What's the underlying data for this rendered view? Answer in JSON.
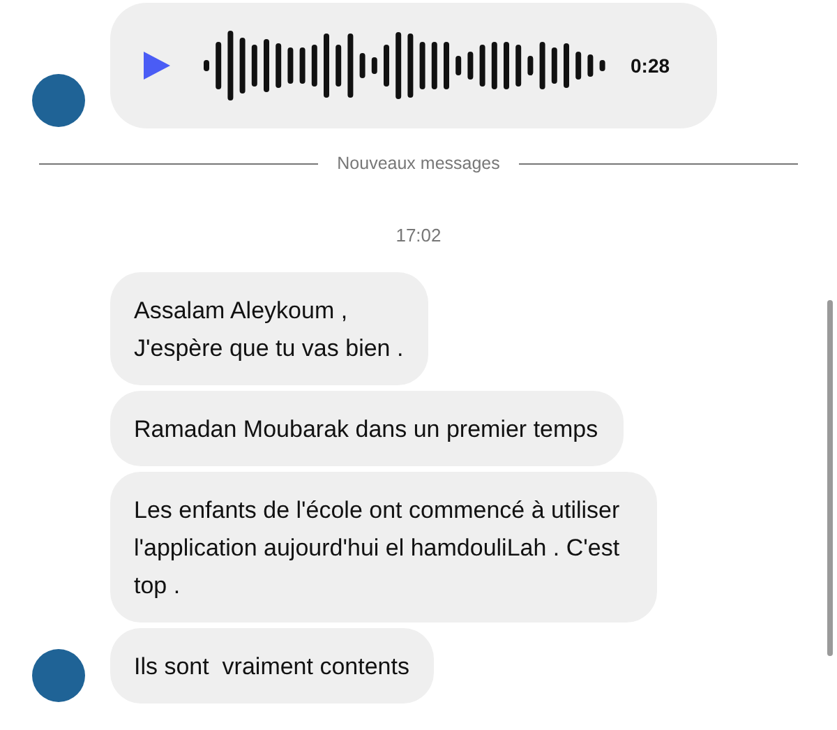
{
  "audio_message": {
    "duration": "0:28"
  },
  "divider": {
    "label": "Nouveaux messages"
  },
  "timestamp": "17:02",
  "messages": [
    {
      "text": "Assalam Aleykoum ,\nJ'espère que tu vas bien ."
    },
    {
      "text": "Ramadan Moubarak dans un premier temps"
    },
    {
      "text": "Les enfants de l'école ont commencé à utiliser l'application aujourd'hui el hamdouliLah . C'est top ."
    },
    {
      "text": "Ils sont  vraiment contents"
    }
  ]
}
